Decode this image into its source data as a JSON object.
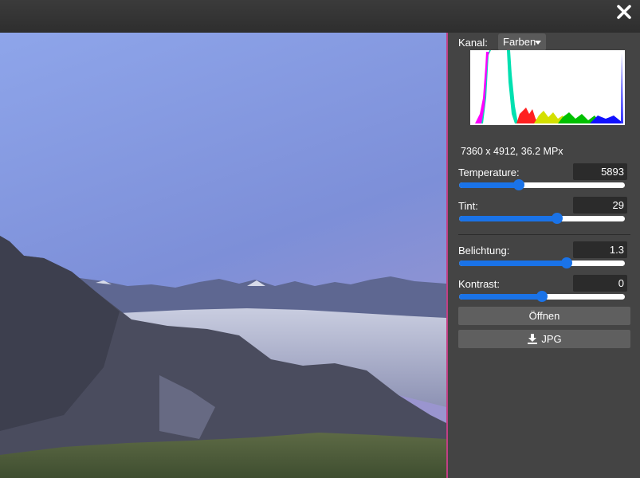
{
  "panel": {
    "channel_label": "Kanal:",
    "channel_value": "Farben",
    "image_info": "7360 x 4912, 36.2 MPx",
    "temperature": {
      "label": "Temperature:",
      "value": "5893",
      "fraction": 0.36
    },
    "tint": {
      "label": "Tint:",
      "value": "29",
      "fraction": 0.59
    },
    "exposure": {
      "label": "Belichtung:",
      "value": "1.3",
      "fraction": 0.65
    },
    "contrast": {
      "label": "Kontrast:",
      "value": "0",
      "fraction": 0.5
    },
    "open_button": "Öffnen",
    "export_button": "JPG"
  },
  "colors": {
    "accent": "#1a73e8",
    "preview_border": "#c23f84",
    "panel_bg": "#444444"
  },
  "icons": {
    "close": "close-icon",
    "download": "download-icon",
    "dropdown": "chevron-down-icon"
  }
}
